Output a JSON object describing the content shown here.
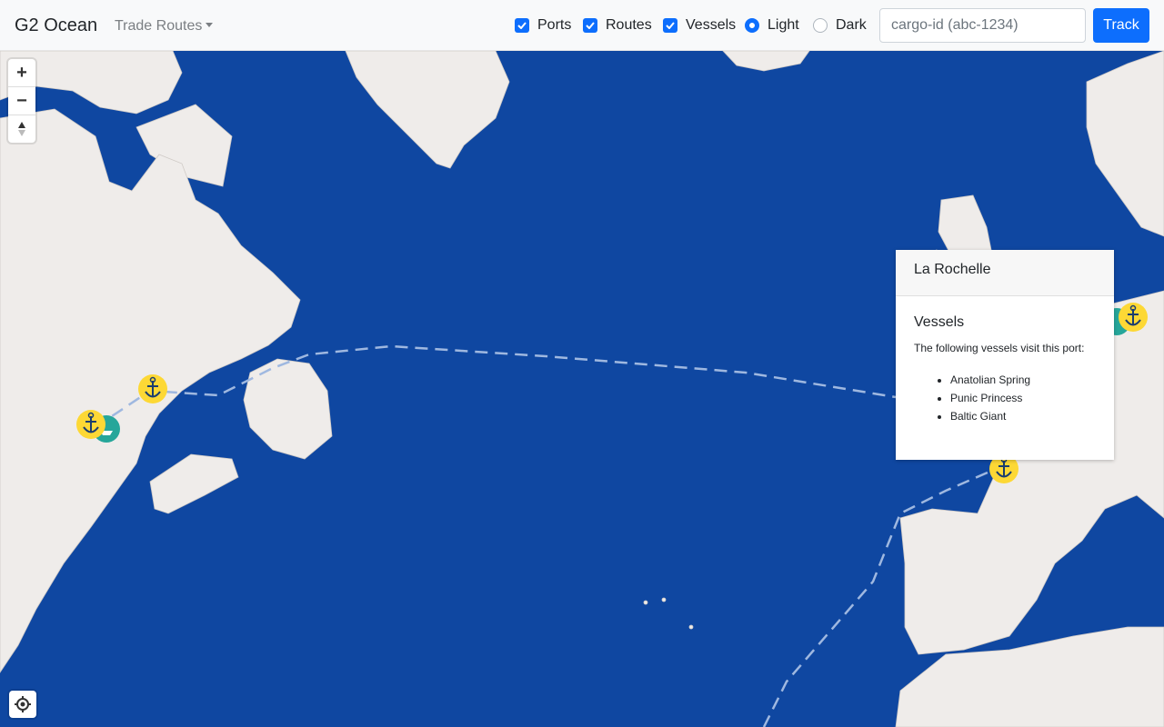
{
  "navbar": {
    "brand": "G2 Ocean",
    "dropdown_label": "Trade Routes",
    "toggles": [
      {
        "label": "Ports",
        "checked": true
      },
      {
        "label": "Routes",
        "checked": true
      },
      {
        "label": "Vessels",
        "checked": true
      }
    ],
    "theme": [
      {
        "label": "Light",
        "selected": true
      },
      {
        "label": "Dark",
        "selected": false
      }
    ],
    "search": {
      "placeholder": "cargo-id (abc-1234)",
      "value": ""
    },
    "track_label": "Track"
  },
  "map_controls": {
    "zoom_in": "+",
    "zoom_out": "−",
    "compass_icon": "compass-icon",
    "locate_icon": "crosshair-icon"
  },
  "colors": {
    "ocean": "#0f47a1",
    "land": "#efecea",
    "port_marker": "#fdd835",
    "vessel_marker": "#26a69a",
    "accent": "#0d6efd"
  },
  "popup": {
    "port_name": "La Rochelle",
    "section_title": "Vessels",
    "description": "The following vessels visit this port:",
    "vessels": [
      "Anatolian Spring",
      "Punic Princess",
      "Baltic Giant"
    ]
  }
}
